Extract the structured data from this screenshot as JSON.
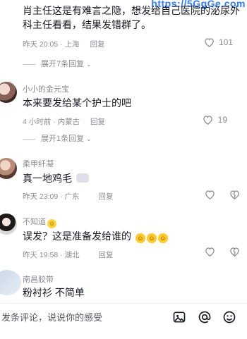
{
  "watermark": "https://5GgGe.com",
  "comments": [
    {
      "text": "肖主任这是有难言之隐，想发给自己医院的泌尿外科主任看看，结果发错群了。",
      "time": "昨天 20:05 · 上海",
      "reply": "回复",
      "likes": "101",
      "expand": "展开7条回复"
    },
    {
      "name": "小小的金元宝",
      "text": "本来要发给某个护士的吧",
      "time": "4 小时前 · 内蒙古",
      "reply": "回复",
      "likes": "19",
      "expand": "展开1条回复"
    },
    {
      "name": "柔甲纤凝",
      "text": "真一地鸡毛",
      "time": "昨天 23:09 · 广东",
      "reply": "回复"
    },
    {
      "name": "不知道",
      "text": "误发？这是准备发给谁的",
      "time": "昨天 19:58 · 湖北",
      "reply": "回复"
    },
    {
      "name": "南昌胶带",
      "text": "粉衬衫   不简单"
    }
  ],
  "input": {
    "placeholder": "发条评论，说说你的感受"
  },
  "icons": {
    "like": "heart-outline-icon",
    "dislike": "broken-heart-icon",
    "image": "image-icon",
    "mention": "at-icon",
    "emoji": "smile-icon",
    "chevron": "chevron-down-icon"
  }
}
